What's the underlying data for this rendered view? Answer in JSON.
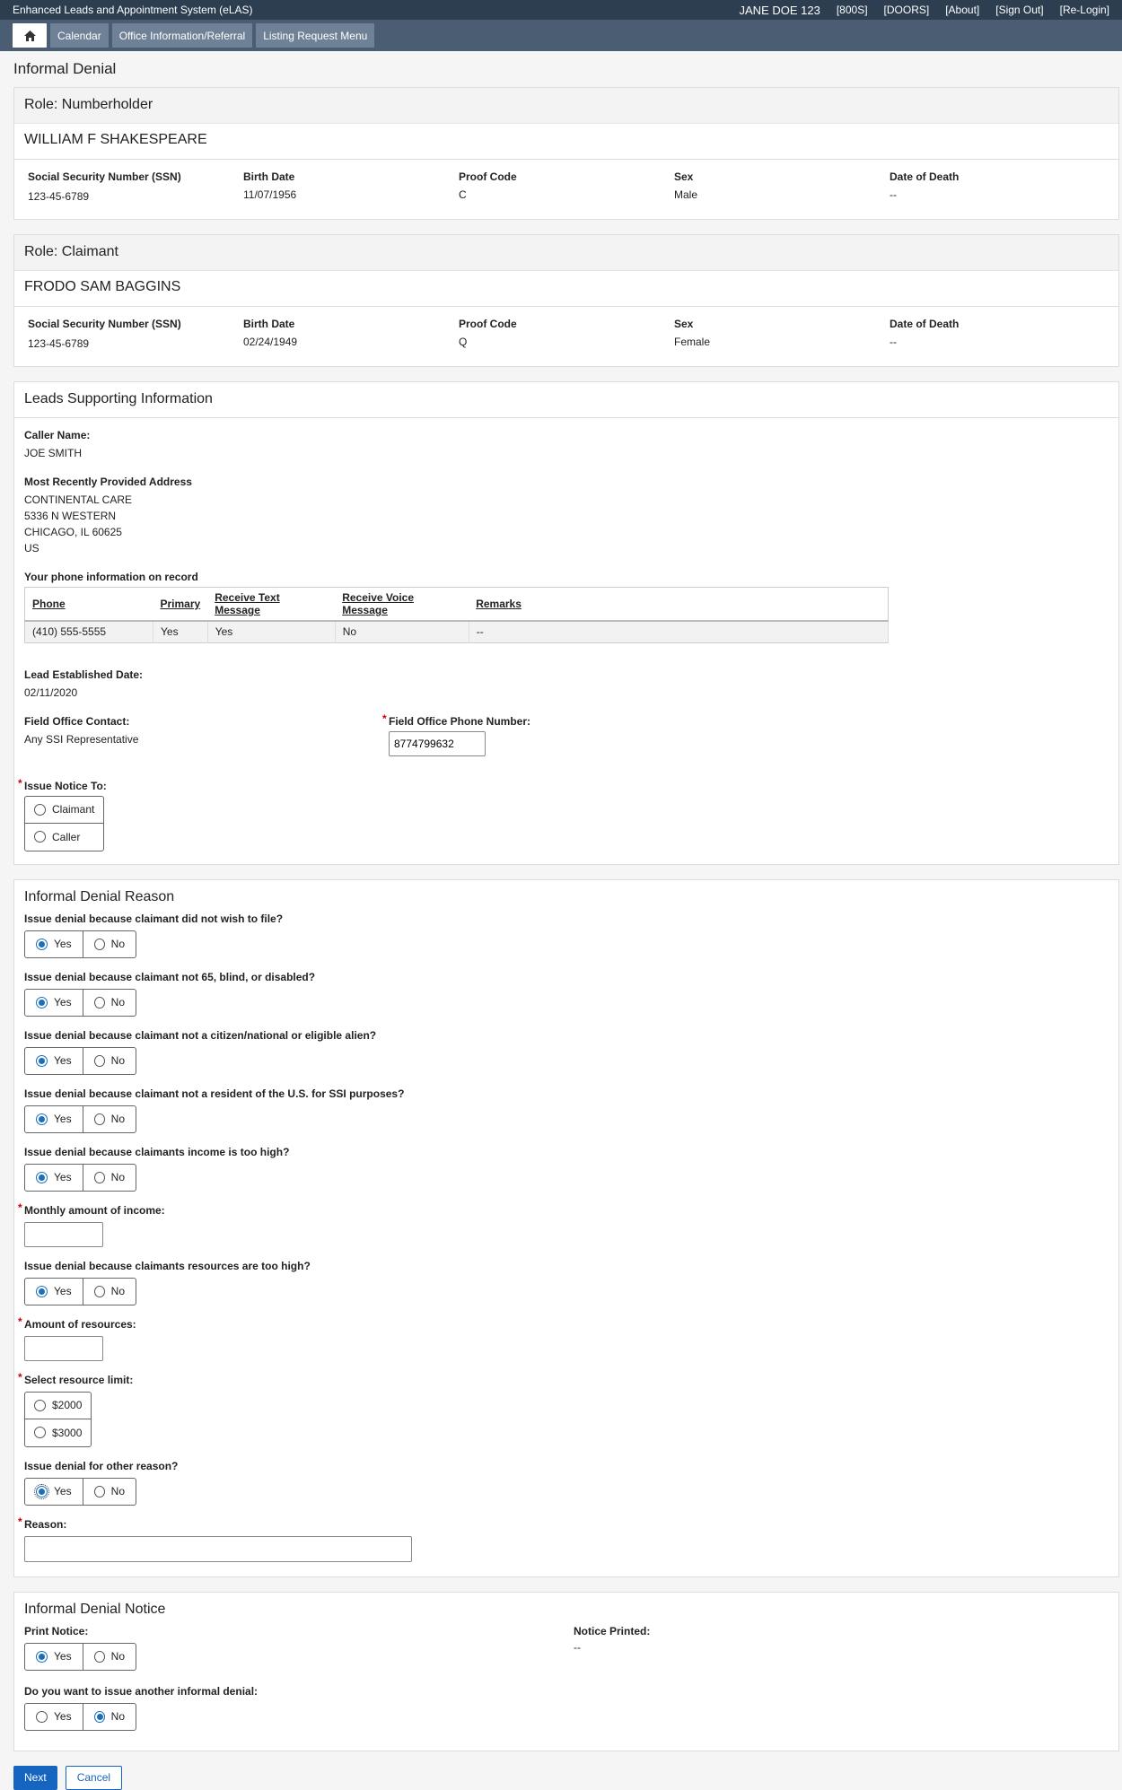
{
  "app": {
    "title": "Enhanced Leads and Appointment System (eLAS)",
    "user": "JANE DOE  123",
    "links": [
      "[800S]",
      "[DOORS]",
      "[About]",
      "[Sign Out]",
      "[Re-Login]"
    ]
  },
  "nav": {
    "home_icon": "home-icon",
    "items": [
      "Calendar",
      "Office Information/Referral",
      "Listing Request Menu"
    ]
  },
  "page_title": "Informal Denial",
  "numberholder": {
    "role": "Role: Numberholder",
    "name": "WILLIAM F SHAKESPEARE",
    "fields": {
      "ssn_label": "Social Security Number (SSN)",
      "ssn": "123-45-6789",
      "birth_label": "Birth Date",
      "birth": "11/07/1956",
      "proof_label": "Proof Code",
      "proof": "C",
      "sex_label": "Sex",
      "sex": "Male",
      "death_label": "Date of Death",
      "death": "--"
    }
  },
  "claimant": {
    "role": "Role: Claimant",
    "name": "FRODO SAM BAGGINS",
    "fields": {
      "ssn_label": "Social Security Number (SSN)",
      "ssn": "123-45-6789",
      "birth_label": "Birth Date",
      "birth": "02/24/1949",
      "proof_label": "Proof Code",
      "proof": "Q",
      "sex_label": "Sex",
      "sex": "Female",
      "death_label": "Date of Death",
      "death": "--"
    }
  },
  "leads": {
    "title": "Leads Supporting Information",
    "caller_label": "Caller Name:",
    "caller": "JOE SMITH",
    "address_label": "Most Recently Provided Address",
    "address": [
      "CONTINENTAL CARE",
      "5336 N WESTERN",
      "CHICAGO, IL 60625",
      "US"
    ],
    "phone_info_label": "Your phone information on record",
    "phone_headers": [
      "Phone",
      "Primary",
      "Receive Text Message",
      "Receive Voice Message",
      "Remarks"
    ],
    "phone_row": [
      "(410) 555-5555",
      "Yes",
      "Yes",
      "No",
      "--"
    ],
    "lead_date_label": "Lead Established Date:",
    "lead_date": "02/11/2020",
    "fo_contact_label": "Field Office Contact:",
    "fo_contact": "Any SSI Representative",
    "fo_phone_label": "Field Office Phone Number:",
    "fo_phone": "8774799632",
    "issue_to_label": "Issue Notice To:",
    "issue_to_options": [
      "Claimant",
      "Caller"
    ]
  },
  "reason": {
    "title": "Informal Denial Reason",
    "yes": "Yes",
    "no": "No",
    "q1": "Issue denial because claimant did not wish to file?",
    "q2": "Issue denial because claimant not 65, blind, or disabled?",
    "q3": "Issue denial because claimant not a citizen/national or eligible alien?",
    "q4": "Issue denial because claimant not a resident of the U.S. for SSI purposes?",
    "q5": "Issue denial because claimants income is too high?",
    "income_label": "Monthly amount of income:",
    "q6": "Issue denial because claimants resources are too high?",
    "resources_label": "Amount of resources:",
    "limit_label": "Select resource limit:",
    "limit_options": [
      "$2000",
      "$3000"
    ],
    "q7": "Issue denial for other reason?",
    "reason_label": "Reason:"
  },
  "notice": {
    "title": "Informal Denial Notice",
    "print_label": "Print Notice:",
    "printed_label": "Notice Printed:",
    "printed": "--",
    "another_label": "Do you want to issue another informal denial:"
  },
  "buttons": {
    "next": "Next",
    "cancel": "Cancel"
  }
}
